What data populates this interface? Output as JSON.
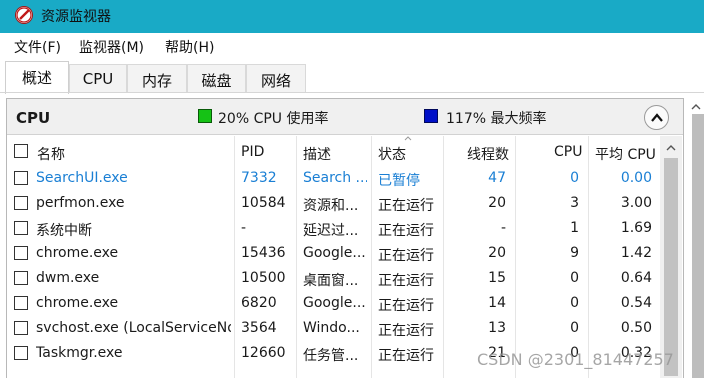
{
  "window": {
    "title": "资源监视器"
  },
  "menu": [
    "文件(F)",
    "监视器(M)",
    "帮助(H)"
  ],
  "tabs": [
    "概述",
    "CPU",
    "内存",
    "磁盘",
    "网络"
  ],
  "panel": {
    "title": "CPU",
    "usage_text": "20% CPU 使用率",
    "freq_text": "117% 最大频率",
    "usage_color": "#15c215",
    "freq_color": "#0010c8"
  },
  "columns": [
    "名称",
    "PID",
    "描述",
    "状态",
    "线程数",
    "CPU",
    "平均 CPU"
  ],
  "rows": [
    {
      "name": "SearchUI.exe",
      "pid": "7332",
      "desc": "Search ...",
      "status": "已暂停",
      "threads": "47",
      "cpu": "0",
      "avg": "0.00",
      "highlight": true
    },
    {
      "name": "perfmon.exe",
      "pid": "10584",
      "desc": "资源和...",
      "status": "正在运行",
      "threads": "20",
      "cpu": "3",
      "avg": "3.00"
    },
    {
      "name": "系统中断",
      "pid": "-",
      "desc": "延迟过...",
      "status": "正在运行",
      "threads": "-",
      "cpu": "1",
      "avg": "1.69"
    },
    {
      "name": "chrome.exe",
      "pid": "15436",
      "desc": "Google...",
      "status": "正在运行",
      "threads": "20",
      "cpu": "9",
      "avg": "1.42"
    },
    {
      "name": "dwm.exe",
      "pid": "10500",
      "desc": "桌面窗...",
      "status": "正在运行",
      "threads": "15",
      "cpu": "0",
      "avg": "0.64"
    },
    {
      "name": "chrome.exe",
      "pid": "6820",
      "desc": "Google...",
      "status": "正在运行",
      "threads": "14",
      "cpu": "0",
      "avg": "0.54"
    },
    {
      "name": "svchost.exe (LocalServiceNo...",
      "pid": "3564",
      "desc": "Windo...",
      "status": "正在运行",
      "threads": "13",
      "cpu": "0",
      "avg": "0.50"
    },
    {
      "name": "Taskmgr.exe",
      "pid": "12660",
      "desc": "任务管...",
      "status": "正在运行",
      "threads": "21",
      "cpu": "0",
      "avg": "0.32"
    }
  ],
  "watermark": "CSDN @2301_81447257",
  "icons": {
    "app": "resource-monitor-icon",
    "collapse": "chevron-up-icon",
    "scroll": "scroll-up-arrow-icon"
  }
}
